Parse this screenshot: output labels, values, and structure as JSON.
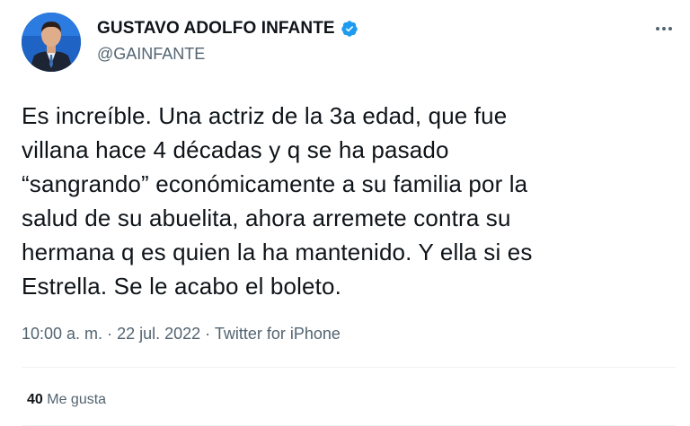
{
  "author": {
    "name": "GUSTAVO ADOLFO INFANTE",
    "handle": "@GAINFANTE",
    "verified": true,
    "avatar_icon": "profile-photo"
  },
  "tweet": {
    "lines": [
      "Es increíble. Una actriz de la 3a edad, que fue",
      "villana hace 4 décadas y q se ha pasado",
      "“sangrando” económicamente a su familia por la",
      "salud de su abuelita, ahora arremete contra su",
      "hermana q es quien la ha mantenido. Y ella si es",
      "Estrella. Se le acabo el boleto."
    ]
  },
  "meta": {
    "time": "10:00 a. m.",
    "separator": " · ",
    "date": "22 jul. 2022",
    "source": "Twitter for iPhone"
  },
  "stats": {
    "likes_count": "40",
    "likes_label": "Me gusta"
  },
  "colors": {
    "verified": "#1d9bf0",
    "secondary_text": "#536471",
    "primary_text": "#0f1419"
  }
}
